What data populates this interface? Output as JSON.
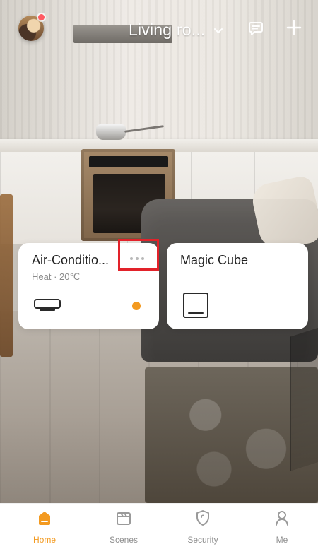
{
  "header": {
    "home_name": "Living ro...",
    "icons": {
      "avatar": "user-avatar",
      "notification_dot": "notification-dot",
      "home_dropdown": "chevron-down-icon",
      "messages": "message-icon",
      "add": "plus-icon"
    }
  },
  "devices": [
    {
      "name": "Air-Conditio...",
      "status": "Heat · 20℃",
      "icon": "air-conditioner-icon",
      "indicator_color": "#F39A20",
      "more_icon": "more-horizontal-icon"
    },
    {
      "name": "Magic Cube",
      "icon": "magic-cube-icon"
    }
  ],
  "bottom_nav": {
    "items": [
      {
        "label": "Home",
        "icon": "home-icon",
        "active": true
      },
      {
        "label": "Scenes",
        "icon": "scenes-icon",
        "active": false
      },
      {
        "label": "Security",
        "icon": "shield-icon",
        "active": false
      },
      {
        "label": "Me",
        "icon": "user-icon",
        "active": false
      }
    ]
  },
  "colors": {
    "accent": "#F39A20",
    "highlight": "#E2222A"
  }
}
